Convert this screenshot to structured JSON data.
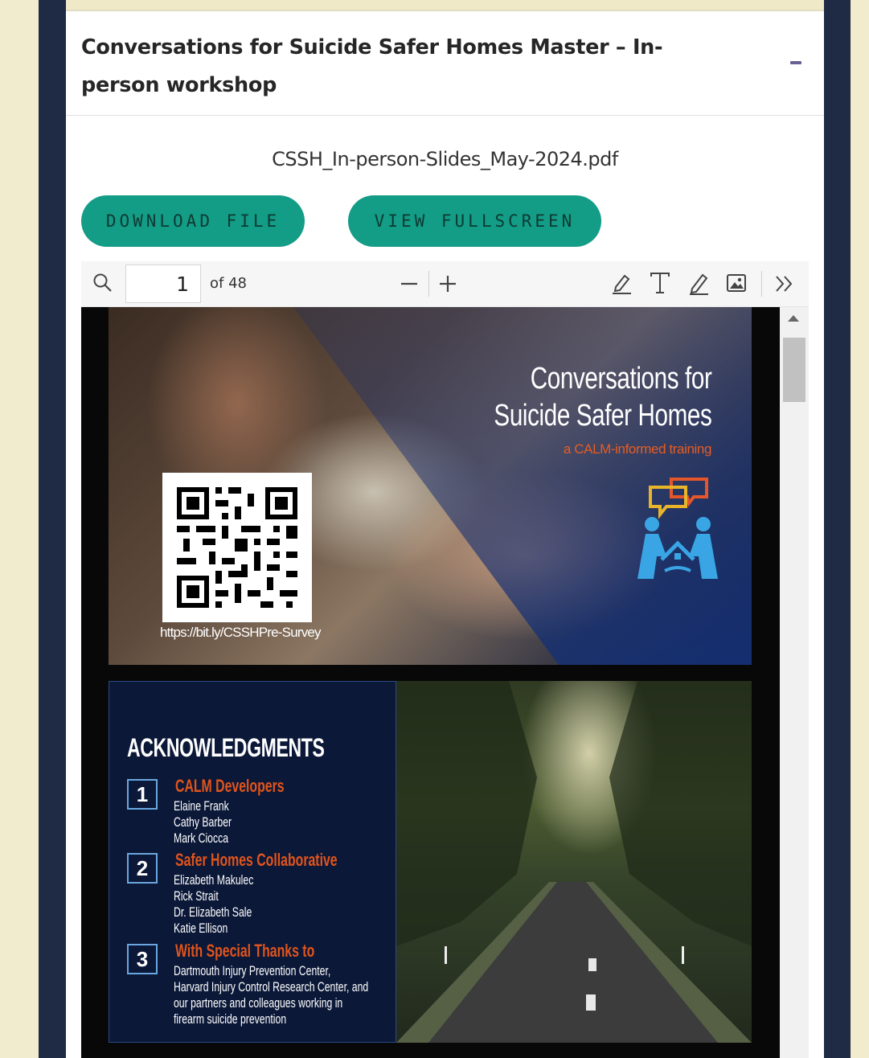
{
  "section": {
    "title": "Conversations for Suicide Safer Homes Master – In-person workshop",
    "collapse_icon": "minus-icon"
  },
  "file": {
    "name": "CSSH_In-person-Slides_May-2024.pdf",
    "download_label": "DOWNLOAD FILE",
    "fullscreen_label": "VIEW FULLSCREEN"
  },
  "viewer": {
    "current_page": "1",
    "page_count_label": "of 48",
    "icons": [
      "search-icon",
      "zoom-out-icon",
      "zoom-in-icon",
      "highlight-icon",
      "text-icon",
      "draw-icon",
      "image-icon",
      "more-tools-icon"
    ]
  },
  "slide1": {
    "title_line1": "Conversations for",
    "title_line2": "Suicide Safer Homes",
    "subtitle": "a CALM-informed training",
    "qr_url": "https://bit.ly/CSSHPre-Survey"
  },
  "slide2": {
    "heading": "ACKNOWLEDGMENTS",
    "items": [
      {
        "num": "1",
        "title": "CALM Developers",
        "lines": [
          "Elaine Frank",
          "Cathy Barber",
          "Mark Ciocca"
        ]
      },
      {
        "num": "2",
        "title": "Safer Homes Collaborative",
        "lines": [
          "Elizabeth Makulec",
          "Rick Strait",
          "Dr. Elizabeth Sale",
          "Katie Ellison"
        ]
      },
      {
        "num": "3",
        "title": "With Special Thanks to",
        "lines": [
          "Dartmouth Injury Prevention Center,",
          "Harvard Injury Control Research Center, and",
          "our partners and colleagues working in",
          "firearm suicide prevention"
        ]
      }
    ]
  },
  "colors": {
    "page_bg": "#f1ecce",
    "frame": "#1f2a45",
    "button": "#139c86",
    "accent": "#e0541c"
  }
}
